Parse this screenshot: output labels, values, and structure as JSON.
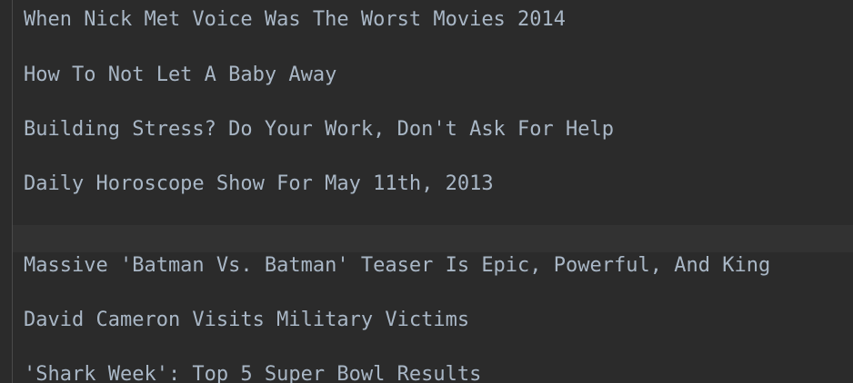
{
  "editor": {
    "current_line": 8,
    "lines": [
      "When Nick Met Voice Was The Worst Movies 2014",
      "",
      "How To Not Let A Baby Away",
      "",
      "Building Stress? Do Your Work, Don't Ask For Help",
      "",
      "Daily Horoscope Show For May 11th, 2013",
      "",
      "",
      "Massive 'Batman Vs. Batman' Teaser Is Epic, Powerful, And King",
      "",
      "David Cameron Visits Military Victims",
      "",
      "'Shark Week': Top 5 Super Bowl Results"
    ]
  },
  "colors": {
    "background": "#2b2b2b",
    "current_line_background": "#323232",
    "text": "#a9b7c6",
    "gutter_divider": "#4a4a4a"
  }
}
